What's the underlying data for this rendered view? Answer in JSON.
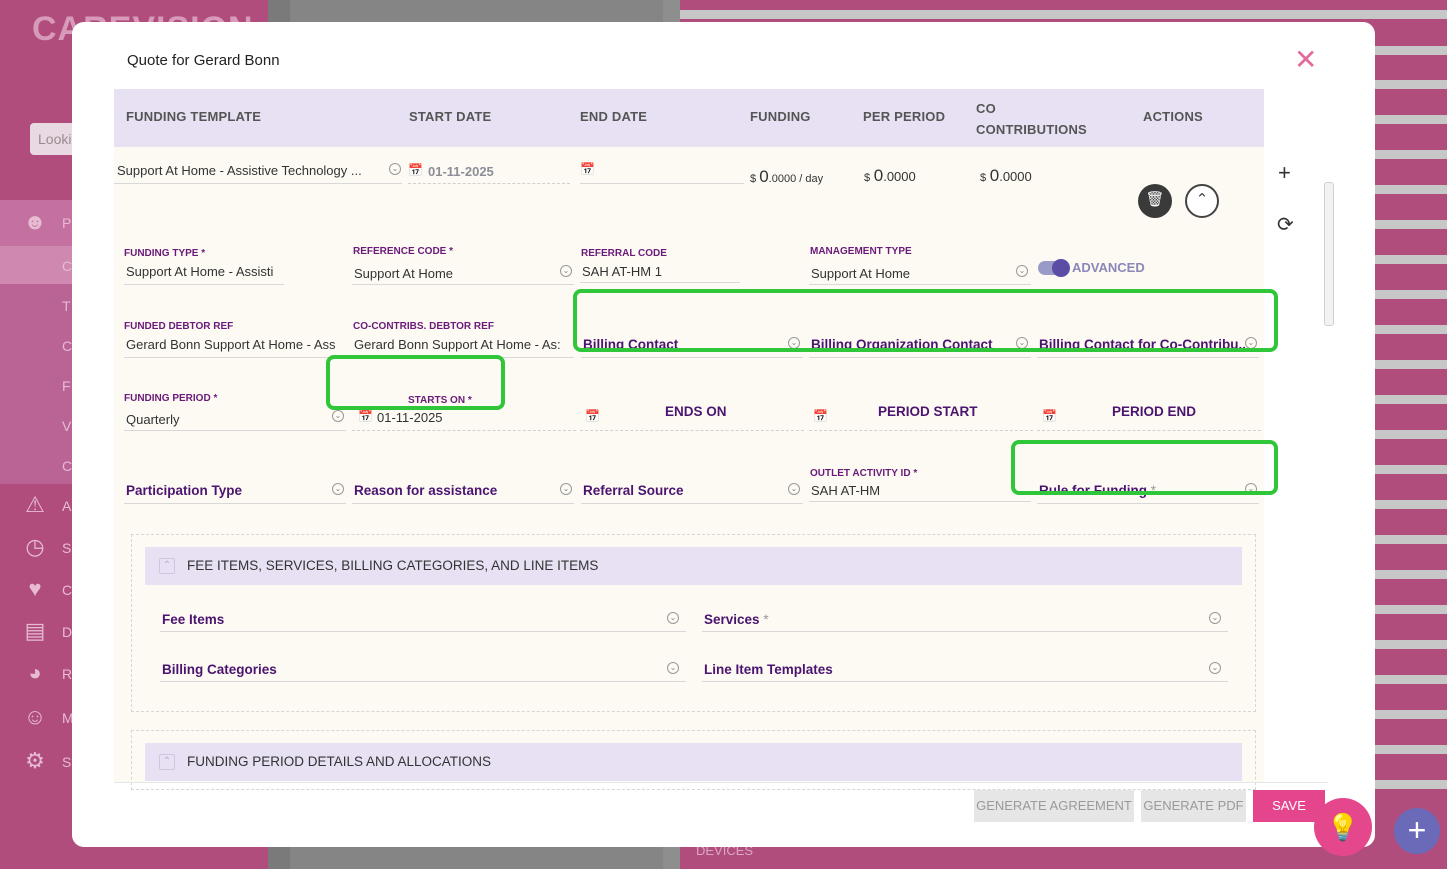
{
  "background": {
    "logo": "CAREVISION",
    "search_placeholder": "Looki",
    "nav_letters": [
      "P",
      "C",
      "T",
      "C",
      "F",
      "V",
      "C",
      "A",
      "S",
      "C",
      "D",
      "R",
      "M",
      "S"
    ],
    "devices_label": "DEVICES"
  },
  "modal": {
    "title": "Quote for Gerard Bonn",
    "columns": {
      "funding_template": "FUNDING TEMPLATE",
      "start_date": "START DATE",
      "end_date": "END DATE",
      "funding": "FUNDING",
      "per_period": "PER PERIOD",
      "co_contributions_1": "CO",
      "co_contributions_2": "CONTRIBUTIONS",
      "actions": "ACTIONS"
    },
    "row": {
      "template": "Support At Home - Assistive Technology ...",
      "start_date": "01-11-2025",
      "end_date": "",
      "funding_currency": "$",
      "funding_amount": "0",
      "funding_decimals": ".0000 / day",
      "per_period_currency": "$",
      "per_period_amount": "0",
      "per_period_decimals": ".0000",
      "co_currency": "$",
      "co_amount": "0",
      "co_decimals": ".0000"
    },
    "fields": {
      "funding_type_label": "FUNDING TYPE *",
      "funding_type_value": "Support At Home - Assisti",
      "reference_code_label": "REFERENCE CODE *",
      "reference_code_value": "Support At Home",
      "referral_code_label": "REFERRAL CODE",
      "referral_code_value": "SAH AT-HM 1",
      "management_type_label": "MANAGEMENT TYPE",
      "management_type_value": "Support At Home",
      "advanced_label": "ADVANCED",
      "funded_debtor_ref_label": "FUNDED DEBTOR REF",
      "funded_debtor_ref_value": "Gerard Bonn Support At Home - Ass",
      "co_contribs_debtor_ref_label": "CO-CONTRIBS. DEBTOR REF",
      "co_contribs_debtor_ref_value": "Gerard Bonn Support At Home - As:",
      "billing_contact": "Billing Contact",
      "billing_org_contact": "Billing Organization Contact",
      "billing_contact_co": "Billing Contact for Co-Contribu...",
      "funding_period_label": "FUNDING PERIOD *",
      "funding_period_value": "Quarterly",
      "starts_on_label": "STARTS ON *",
      "starts_on_value": "01-11-2025",
      "ends_on": "ENDS ON",
      "period_start": "PERIOD START",
      "period_end": "PERIOD END",
      "participation_type": "Participation Type",
      "reason_for_assistance": "Reason for assistance",
      "referral_source": "Referral Source",
      "outlet_activity_id_label": "OUTLET ACTIVITY ID *",
      "outlet_activity_id_value": "SAH AT-HM",
      "rule_for_funding": "Rule for Funding",
      "required_star": "*"
    },
    "section_fee": {
      "title": "FEE ITEMS, SERVICES, BILLING CATEGORIES, AND LINE ITEMS",
      "fee_items": "Fee Items",
      "services": "Services",
      "billing_categories": "Billing Categories",
      "line_item_templates": "Line Item Templates"
    },
    "section_period": {
      "title": "FUNDING PERIOD DETAILS AND ALLOCATIONS"
    },
    "footer": {
      "generate_agreement": "GENERATE AGREEMENT",
      "generate_pdf": "GENERATE PDF",
      "save": "SAVE"
    }
  },
  "colors": {
    "brand_pink": "#e4458d",
    "highlight_green": "#2fc63a",
    "header_lavender": "#e8e1f4",
    "label_purple": "#4b1470"
  }
}
